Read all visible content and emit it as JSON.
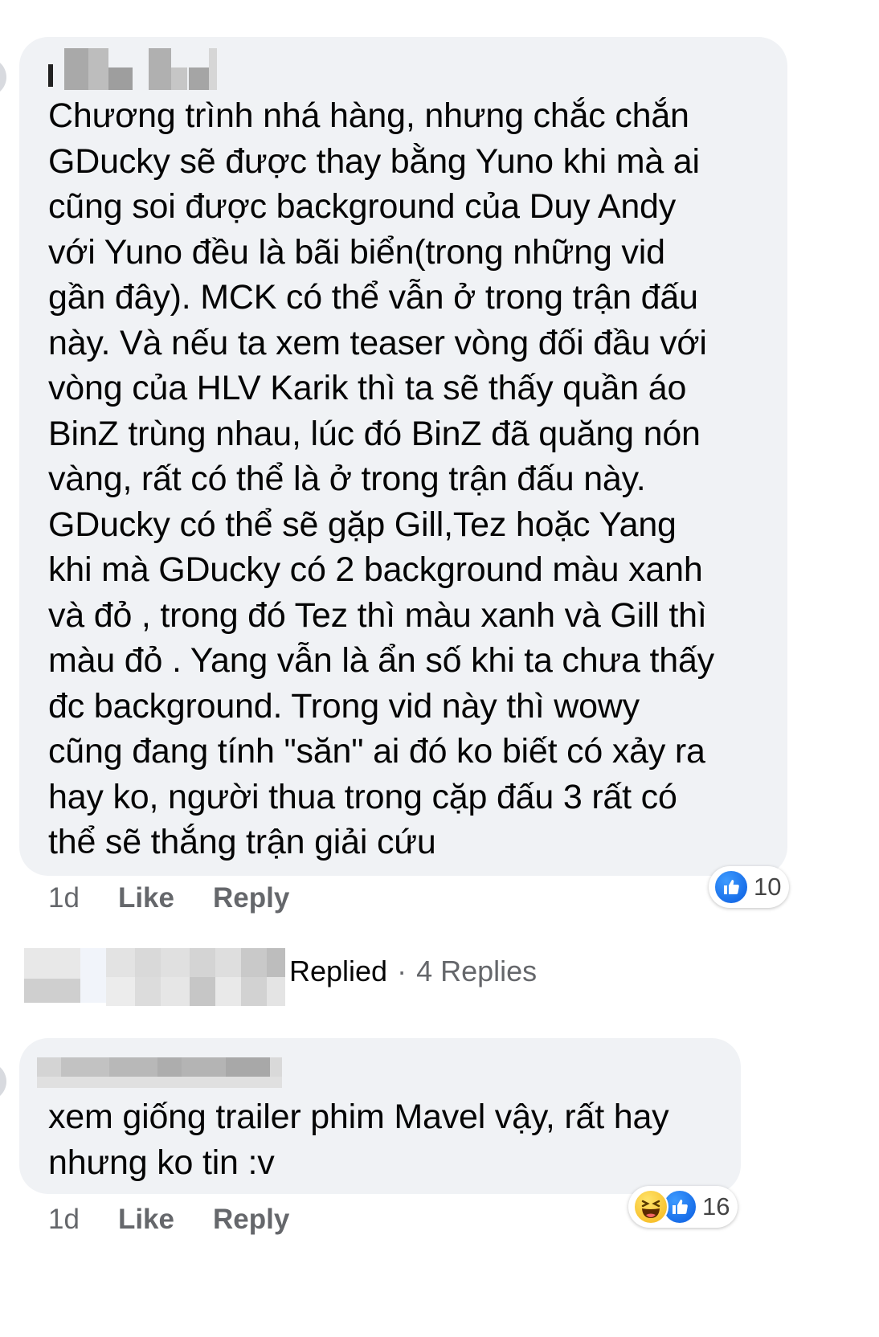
{
  "comment1": {
    "author_blurred": "",
    "text": "Chương trình nhá hàng, nhưng chắc chắn\nGDucky sẽ được thay bằng Yuno khi mà ai\ncũng soi được background của Duy Andy\nvới Yuno đều là bãi biển(trong những vid\ngần đây). MCK có thể vẫn ở trong trận đấu\nnày. Và nếu ta xem teaser vòng đối đầu với\nvòng của HLV Karik thì ta sẽ thấy quần áo\nBinZ trùng nhau, lúc đó BinZ đã quăng nón\nvàng, rất có thể là ở trong trận đấu này.\nGDucky có thể sẽ gặp Gill,Tez hoặc Yang\nkhi mà GDucky có 2 background màu xanh\nvà đỏ , trong đó Tez thì màu xanh và Gill thì\nmàu đỏ . Yang vẫn là ẩn số khi ta chưa thấy\nđc background. Trong vid này thì wowy\ncũng đang tính \"săn\" ai đó ko biết có xảy ra\nhay ko, người thua trong cặp đấu 3 rất có\nthể sẽ thắng trận giải cứu",
    "time": "1d",
    "like_label": "Like",
    "reply_label": "Reply",
    "reaction_count": "10",
    "reaction_icons": [
      "like-icon"
    ]
  },
  "replies_summary": {
    "label": "Replied",
    "separator": "·",
    "count_label": "4 Replies"
  },
  "comment2": {
    "author_blurred": "",
    "text": "xem giống trailer phim Mavel vậy, rất hay\nnhưng ko tin :v",
    "time": "1d",
    "like_label": "Like",
    "reply_label": "Reply",
    "reaction_count": "16",
    "reaction_icons": [
      "haha-icon",
      "like-icon"
    ]
  },
  "colors": {
    "bubble": "#f0f2f5",
    "secondary_text": "#65676b",
    "like_blue": "#1877f2"
  }
}
